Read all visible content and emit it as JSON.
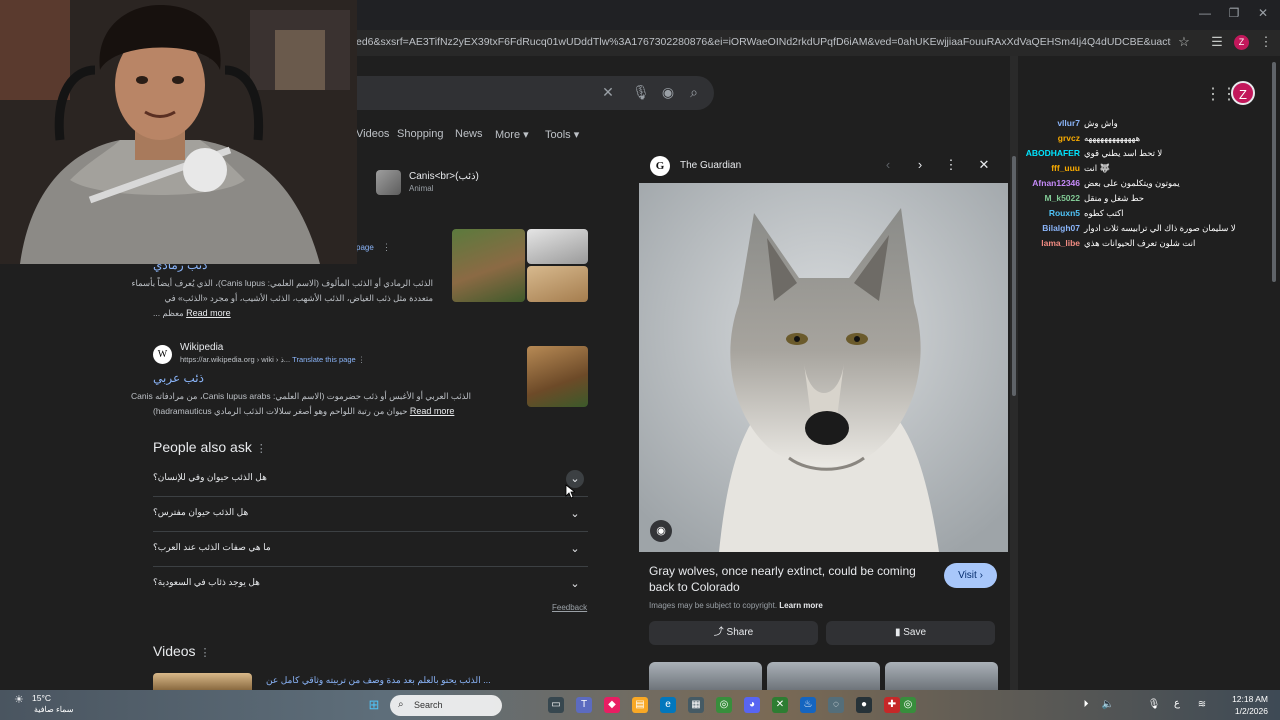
{
  "browser": {
    "url": "ed6&sxsrf=AE3TifNz2yEX39txF6FdRucq01wUDddTlw%3A1767302280876&ei=iORWaeOINd2rkdUPqfD6iAM&ved=0ahUKEwjjiaaFouuRAxXdVaQEHSm4Ij4Q4dUDCBE&uact=5&oq=ذيب+حيوان&gs_l...",
    "profile_initial": "Z"
  },
  "search": {
    "tabs": [
      "Videos",
      "Shopping",
      "News",
      "More",
      "Tools"
    ]
  },
  "knowledge_chip": {
    "title": "Canis<br>(ذئب)",
    "subtitle": "Animal"
  },
  "results": [
    {
      "translate": "Translate this page",
      "title": "ذئب رمادي",
      "snippet_line1": "الذئب الرمادي أو الذئب المألوف (الاسم العلمي: Canis lupus)، الذي يُعرف أيضاً بأسماء",
      "snippet_line2": "متعددة مثل ذئب الغياض، الذئب الأشهب، الذئب الأشيب، أو مجرد «الذئب» في",
      "snippet_line3": "... معظم",
      "read_more": "Read more"
    },
    {
      "site": "Wikipedia",
      "crumb": "https://ar.wikipedia.org › wiki › ذ...",
      "translate": "Translate this page",
      "title": "ذئب عربي",
      "snippet_line1": "الذئب العربي أو الأغبس أو ذئب حضرموت (الاسم العلمي: Canis lupus arabs، من مرادفاته Canis",
      "snippet_line2": "(hadramauticus حيوان من رتبة اللواحم وهو أصغر سلالات الذئب الرمادي",
      "read_more": "Read more"
    }
  ],
  "people_also_ask": {
    "title": "People also ask",
    "questions": [
      "هل الذئب حيوان وفي للإنسان؟",
      "هل الذئب حيوان مفترس؟",
      "ما هي صفات الذئب عند العرب؟",
      "هل يوجد ذئاب في السعودية؟"
    ],
    "feedback": "Feedback"
  },
  "videos": {
    "title": "Videos",
    "first_caption": "الذئب يحنو بالعلم بعد مدة وصف من تربيته وثاقي كامل عن ..."
  },
  "side_panel": {
    "source": "The Guardian",
    "headline": "Gray wolves, once nearly extinct, could be coming back to Colorado",
    "visit": "Visit",
    "copyright": "Images may be subject to copyright.",
    "learn_more": "Learn more",
    "share": "Share",
    "save": "Save"
  },
  "chat": [
    {
      "user": "vllur7",
      "msg": "واش وش",
      "color": "#8ab4f8"
    },
    {
      "user": "grvcz",
      "msg": "هههههههههههههه",
      "color": "#f9ab00"
    },
    {
      "user": "ABODHAFER",
      "msg": "لا تحط اسد يطني قوي",
      "color": "#00e5ff"
    },
    {
      "user": "fff_uuu",
      "msg": "انت 🐺",
      "color": "#f9ab00"
    },
    {
      "user": "Afnan12346",
      "msg": "يموتون ويتكلمون على بعض",
      "color": "#c58af9"
    },
    {
      "user": "M_k5022",
      "msg": "حط شغل و منقل",
      "color": "#81c995"
    },
    {
      "user": "Rouxn5",
      "msg": "اكتب كطوه",
      "color": "#4fc3f7"
    },
    {
      "user": "Bilalgh07",
      "msg": "لا سليمان صورة ذاك الي ترابيسه ثلاث ادوار",
      "color": "#8ab4f8"
    },
    {
      "user": "lama_libe",
      "msg": "انت شلون تعرف الحيوانات هذي",
      "color": "#f28b82"
    }
  ],
  "taskbar": {
    "weather_temp": "15°C",
    "weather_desc": "سماء صافية",
    "search": "Search",
    "lang": "ع",
    "time": "12:18 AM",
    "date": "1/2/2026"
  }
}
